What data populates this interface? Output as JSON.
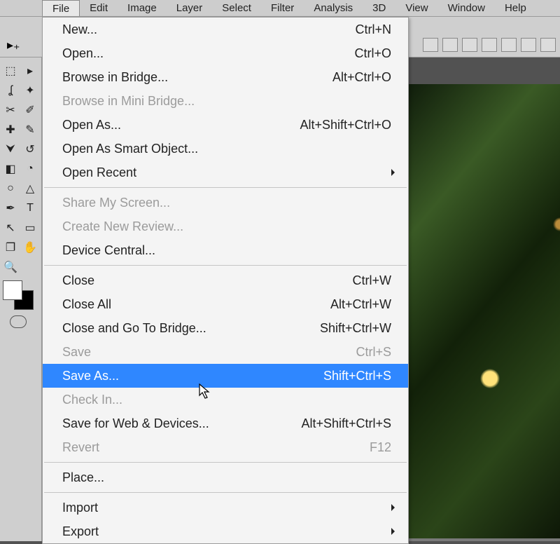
{
  "menubar": {
    "items": [
      "File",
      "Edit",
      "Image",
      "Layer",
      "Select",
      "Filter",
      "Analysis",
      "3D",
      "View",
      "Window",
      "Help"
    ],
    "active_index": 0
  },
  "options_bar": {
    "move_icon_glyph": "▸₊",
    "right_buttons": [
      "align-left",
      "align-center",
      "align-right",
      "dist-top",
      "dist-mid",
      "dist-bot",
      "more"
    ]
  },
  "tools": {
    "items": [
      {
        "name": "marquee",
        "glyph": "⬚"
      },
      {
        "name": "move",
        "glyph": "▸"
      },
      {
        "name": "lasso",
        "glyph": "ʆ"
      },
      {
        "name": "wand",
        "glyph": "✦"
      },
      {
        "name": "crop",
        "glyph": "✂"
      },
      {
        "name": "eyedrop",
        "glyph": "✐"
      },
      {
        "name": "heal",
        "glyph": "✚"
      },
      {
        "name": "brush",
        "glyph": "✎"
      },
      {
        "name": "stamp",
        "glyph": "⮟"
      },
      {
        "name": "history",
        "glyph": "↺"
      },
      {
        "name": "eraser",
        "glyph": "◧"
      },
      {
        "name": "paint",
        "glyph": "◔"
      },
      {
        "name": "dodge",
        "glyph": "○"
      },
      {
        "name": "blur",
        "glyph": "△"
      },
      {
        "name": "pen",
        "glyph": "✒"
      },
      {
        "name": "type",
        "glyph": "T"
      },
      {
        "name": "path",
        "glyph": "↖"
      },
      {
        "name": "shape",
        "glyph": "▭"
      },
      {
        "name": "notes",
        "glyph": "❐"
      },
      {
        "name": "hand",
        "glyph": "✋"
      },
      {
        "name": "zoom",
        "glyph": "🔍"
      }
    ]
  },
  "file_menu": [
    {
      "label": "New...",
      "shortcut": "Ctrl+N",
      "enabled": true
    },
    {
      "label": "Open...",
      "shortcut": "Ctrl+O",
      "enabled": true
    },
    {
      "label": "Browse in Bridge...",
      "shortcut": "Alt+Ctrl+O",
      "enabled": true
    },
    {
      "label": "Browse in Mini Bridge...",
      "shortcut": "",
      "enabled": false
    },
    {
      "label": "Open As...",
      "shortcut": "Alt+Shift+Ctrl+O",
      "enabled": true
    },
    {
      "label": "Open As Smart Object...",
      "shortcut": "",
      "enabled": true
    },
    {
      "label": "Open Recent",
      "shortcut": "",
      "enabled": true,
      "submenu": true
    },
    {
      "sep": true
    },
    {
      "label": "Share My Screen...",
      "shortcut": "",
      "enabled": false
    },
    {
      "label": "Create New Review...",
      "shortcut": "",
      "enabled": false
    },
    {
      "label": "Device Central...",
      "shortcut": "",
      "enabled": true
    },
    {
      "sep": true
    },
    {
      "label": "Close",
      "shortcut": "Ctrl+W",
      "enabled": true
    },
    {
      "label": "Close All",
      "shortcut": "Alt+Ctrl+W",
      "enabled": true
    },
    {
      "label": "Close and Go To Bridge...",
      "shortcut": "Shift+Ctrl+W",
      "enabled": true
    },
    {
      "label": "Save",
      "shortcut": "Ctrl+S",
      "enabled": false
    },
    {
      "label": "Save As...",
      "shortcut": "Shift+Ctrl+S",
      "enabled": true,
      "selected": true
    },
    {
      "label": "Check In...",
      "shortcut": "",
      "enabled": false
    },
    {
      "label": "Save for Web & Devices...",
      "shortcut": "Alt+Shift+Ctrl+S",
      "enabled": true
    },
    {
      "label": "Revert",
      "shortcut": "F12",
      "enabled": false
    },
    {
      "sep": true
    },
    {
      "label": "Place...",
      "shortcut": "",
      "enabled": true
    },
    {
      "sep": true
    },
    {
      "label": "Import",
      "shortcut": "",
      "enabled": true,
      "submenu": true
    },
    {
      "label": "Export",
      "shortcut": "",
      "enabled": true,
      "submenu": true
    }
  ]
}
